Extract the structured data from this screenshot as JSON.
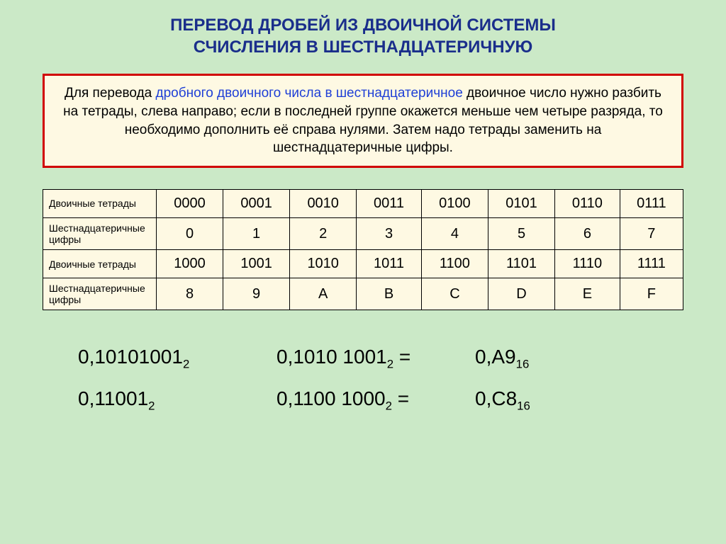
{
  "title_line1": "ПЕРЕВОД ДРОБЕЙ ИЗ ДВОИЧНОЙ СИСТЕМЫ",
  "title_line2": "СЧИСЛЕНИЯ В ШЕСТНАДЦАТЕРИЧНУЮ",
  "rule": {
    "part1": "Для перевода ",
    "hl": "дробного двоичного числа в шестнадцатеричное",
    "part2": " двоичное число нужно разбить на тетрады, слева направо; если в последней группе окажется меньше чем четыре разряда, то необходимо дополнить её справа нулями. Затем надо тетрады заменить на шестнадцатеричные цифры."
  },
  "table": {
    "row1_head": "Двоичные тетрады",
    "row1": [
      "0000",
      "0001",
      "0010",
      "0011",
      "0100",
      "0101",
      "0110",
      "0111"
    ],
    "row2_head": "Шестнадцатеричные цифры",
    "row2": [
      "0",
      "1",
      "2",
      "3",
      "4",
      "5",
      "6",
      "7"
    ],
    "row3_head": "Двоичные тетрады",
    "row3": [
      "1000",
      "1001",
      "1010",
      "1011",
      "1100",
      "1101",
      "1110",
      "1111"
    ],
    "row4_head": "Шестнадцатеричные цифры",
    "row4": [
      "8",
      "9",
      "A",
      "B",
      "C",
      "D",
      "E",
      "F"
    ]
  },
  "examples": {
    "e1": {
      "left": "0,10101001",
      "lsub": "2",
      "mid": "0,1010 1001",
      "msub": "2",
      "eq": " = ",
      "res": "0,A9",
      "rsub": "16"
    },
    "e2": {
      "left": "0,11001",
      "lsub": "2",
      "mid": "0,1100 1000",
      "msub": "2",
      "eq": " = ",
      "res": "0,C8",
      "rsub": "16"
    }
  }
}
